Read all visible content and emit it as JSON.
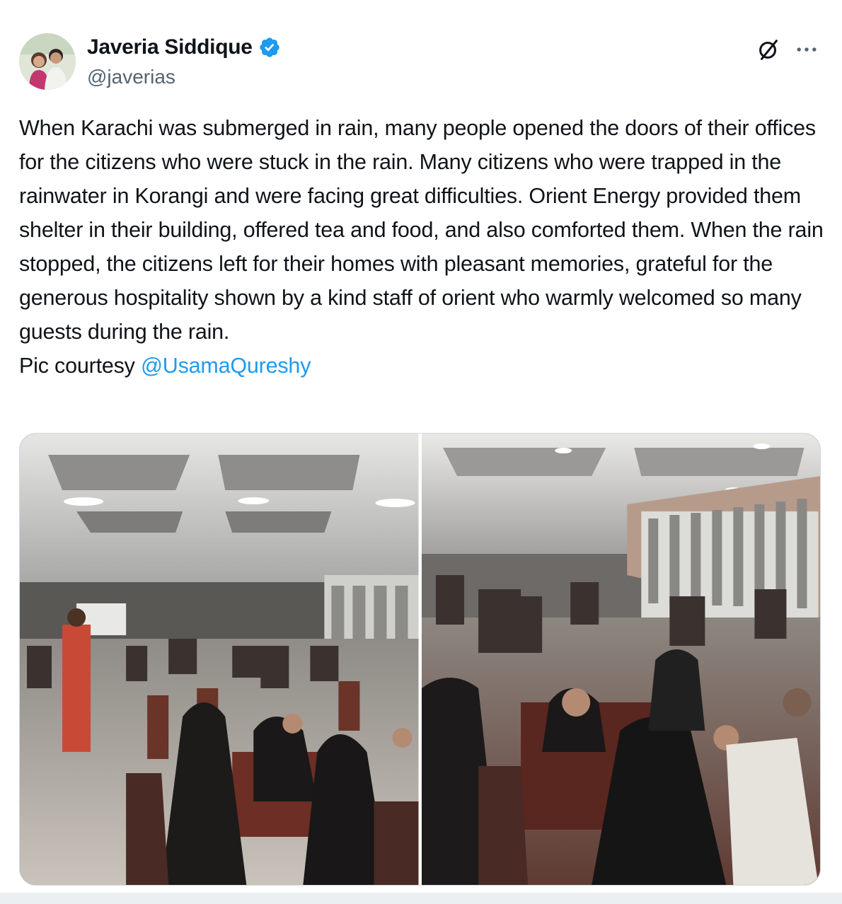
{
  "author": {
    "display_name": "Javeria Siddique",
    "handle": "@javerias",
    "verified": true,
    "avatar_icon": "profile-photo-avatar"
  },
  "actions": {
    "grok_icon": "grok-icon",
    "more_icon": "more-options-icon"
  },
  "tweet": {
    "text_main": "When Karachi was submerged in rain, many people opened the doors of their offices for the citizens who were stuck in the rain. Many citizens who were trapped in the rainwater in Korangi and were facing great difficulties. Orient Energy provided them shelter in their building, offered tea and food, and also comforted them. When the rain stopped, the citizens left for their homes with pleasant memories, grateful for the generous hospitality shown by a kind staff of orient who warmly welcomed so many guests during the rain.",
    "courtesy_prefix": "Pic courtesy ",
    "courtesy_mention": "@UsamaQureshy"
  },
  "colors": {
    "link": "#1d9bf0",
    "verified": "#1d9bf0",
    "secondary_text": "#536471"
  }
}
